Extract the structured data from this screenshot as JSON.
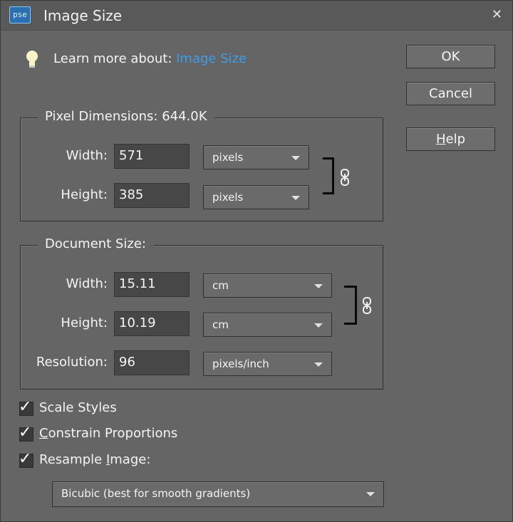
{
  "window": {
    "app_badge": "pse",
    "title": "Image Size",
    "close_glyph": "✕"
  },
  "tip": {
    "icon": "lightbulb-icon",
    "prefix": "Learn more about: ",
    "link": "Image Size"
  },
  "buttons": {
    "ok": "OK",
    "cancel": "Cancel",
    "help_mnemonic": "H",
    "help_rest": "elp"
  },
  "pixel_dimensions": {
    "legend": "Pixel Dimensions:  644.0K",
    "width_label": "Width:",
    "width_value": "571",
    "width_unit": "pixels",
    "height_label": "Height:",
    "height_value": "385",
    "height_unit": "pixels"
  },
  "document_size": {
    "legend": "Document Size:",
    "width_label": "Width:",
    "width_value": "15.11",
    "width_unit": "cm",
    "height_label": "Height:",
    "height_value": "10.19",
    "height_unit": "cm",
    "resolution_label": "Resolution:",
    "resolution_value": "96",
    "resolution_unit": "pixels/inch"
  },
  "options": {
    "scale_styles": "Scale Styles",
    "constrain_mnemonic": "C",
    "constrain_rest": "onstrain Proportions",
    "resample_pre": "Resample ",
    "resample_mnemonic": "I",
    "resample_rest": "mage:",
    "check_glyph": "✓",
    "scale_styles_checked": true,
    "constrain_checked": true,
    "resample_checked": true
  },
  "resample_method": "Bicubic (best for smooth gradients)",
  "colors": {
    "link": "#3d9ce6",
    "dialog_bg": "#656565",
    "field_bg": "#474747"
  }
}
